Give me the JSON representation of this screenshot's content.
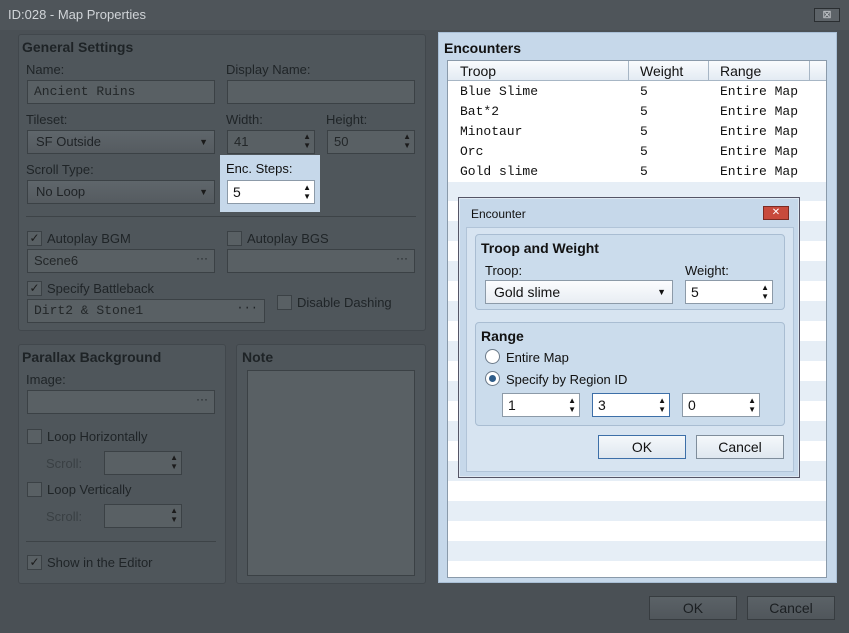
{
  "window": {
    "title": "ID:028 - Map Properties",
    "close": "⊠"
  },
  "general": {
    "header": "General Settings",
    "name_label": "Name:",
    "name_value": "Ancient Ruins",
    "display_name_label": "Display Name:",
    "display_name_value": "",
    "tileset_label": "Tileset:",
    "tileset_value": "SF Outside",
    "width_label": "Width:",
    "width_value": "41",
    "height_label": "Height:",
    "height_value": "50",
    "scroll_type_label": "Scroll Type:",
    "scroll_type_value": "No Loop",
    "enc_steps_label": "Enc. Steps:",
    "enc_steps_value": "5",
    "autoplay_bgm_label": "Autoplay BGM",
    "autoplay_bgm_value": "Scene6",
    "autoplay_bgs_label": "Autoplay BGS",
    "autoplay_bgs_value": "",
    "specify_battleback_label": "Specify Battleback",
    "battleback_value": "Dirt2 & Stone1",
    "disable_dashing_label": "Disable Dashing",
    "ellipsis": "···"
  },
  "parallax": {
    "header": "Parallax Background",
    "image_label": "Image:",
    "image_value": "",
    "loop_h_label": "Loop Horizontally",
    "scroll_label_1": "Scroll:",
    "loop_v_label": "Loop Vertically",
    "scroll_label_2": "Scroll:",
    "show_editor_label": "Show in the Editor"
  },
  "note": {
    "header": "Note",
    "value": ""
  },
  "encounters": {
    "header": "Encounters",
    "columns": [
      "Troop",
      "Weight",
      "Range"
    ],
    "rows": [
      {
        "troop": "Blue Slime",
        "weight": "5",
        "range": "Entire Map"
      },
      {
        "troop": "Bat*2",
        "weight": "5",
        "range": "Entire Map"
      },
      {
        "troop": "Minotaur",
        "weight": "5",
        "range": "Entire Map"
      },
      {
        "troop": "Orc",
        "weight": "5",
        "range": "Entire Map"
      },
      {
        "troop": "Gold slime",
        "weight": "5",
        "range": "Entire Map"
      }
    ]
  },
  "dialog": {
    "title": "Encounter",
    "close": "✕",
    "troop_weight_header": "Troop and Weight",
    "troop_label": "Troop:",
    "troop_value": "Gold slime",
    "weight_label": "Weight:",
    "weight_value": "5",
    "range_header": "Range",
    "entire_map_label": "Entire Map",
    "region_label": "Specify by Region ID",
    "region_values": [
      "1",
      "3",
      "0"
    ],
    "ok_label": "OK",
    "cancel_label": "Cancel"
  },
  "footer": {
    "ok_label": "OK",
    "cancel_label": "Cancel"
  },
  "glyphs": {
    "check": "✓",
    "arrow_down": "▼",
    "spin": "▲\n▼"
  },
  "colors": {
    "accent": "#c6d8ea",
    "dim_background": "#4a5055",
    "close_red": "#c84a3c"
  }
}
